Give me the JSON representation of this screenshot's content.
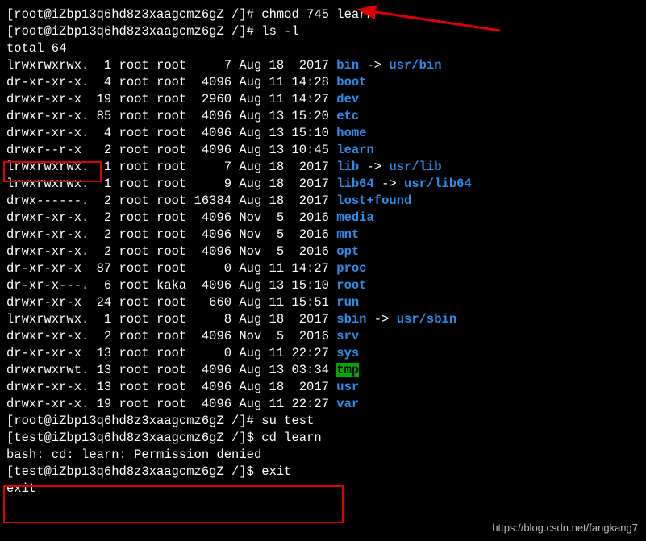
{
  "prompts": {
    "root": "[root@iZbp13q6hd8z3xaagcmz6gZ /]# ",
    "test": "[test@iZbp13q6hd8z3xaagcmz6gZ /]$ "
  },
  "cmds": {
    "chmod": "chmod 745 learn",
    "lsl": "ls -l",
    "su": "su test",
    "cd": "cd learn",
    "exit": "exit"
  },
  "total": "total 64",
  "arrow": " -> ",
  "rows": [
    {
      "perm": "lrwxrwxrwx.",
      "links": "1",
      "owner": "root",
      "group": "root",
      "size": "7",
      "date": "Aug 18  2017",
      "name": "bin",
      "type": "link",
      "target": "usr/bin"
    },
    {
      "perm": "dr-xr-xr-x.",
      "links": "4",
      "owner": "root",
      "group": "root",
      "size": "4096",
      "date": "Aug 11 14:28",
      "name": "boot",
      "type": "dir"
    },
    {
      "perm": "drwxr-xr-x",
      "links": "19",
      "owner": "root",
      "group": "root",
      "size": "2960",
      "date": "Aug 11 14:27",
      "name": "dev",
      "type": "dir"
    },
    {
      "perm": "drwxr-xr-x.",
      "links": "85",
      "owner": "root",
      "group": "root",
      "size": "4096",
      "date": "Aug 13 15:20",
      "name": "etc",
      "type": "dir"
    },
    {
      "perm": "drwxr-xr-x.",
      "links": "4",
      "owner": "root",
      "group": "root",
      "size": "4096",
      "date": "Aug 13 15:10",
      "name": "home",
      "type": "dir"
    },
    {
      "perm": "drwxr--r-x",
      "links": "2",
      "owner": "root",
      "group": "root",
      "size": "4096",
      "date": "Aug 13 10:45",
      "name": "learn",
      "type": "dir"
    },
    {
      "perm": "lrwxrwxrwx.",
      "links": "1",
      "owner": "root",
      "group": "root",
      "size": "7",
      "date": "Aug 18  2017",
      "name": "lib",
      "type": "link",
      "target": "usr/lib"
    },
    {
      "perm": "lrwxrwxrwx.",
      "links": "1",
      "owner": "root",
      "group": "root",
      "size": "9",
      "date": "Aug 18  2017",
      "name": "lib64",
      "type": "link",
      "target": "usr/lib64"
    },
    {
      "perm": "drwx------.",
      "links": "2",
      "owner": "root",
      "group": "root",
      "size": "16384",
      "date": "Aug 18  2017",
      "name": "lost+found",
      "type": "dir"
    },
    {
      "perm": "drwxr-xr-x.",
      "links": "2",
      "owner": "root",
      "group": "root",
      "size": "4096",
      "date": "Nov  5  2016",
      "name": "media",
      "type": "dir"
    },
    {
      "perm": "drwxr-xr-x.",
      "links": "2",
      "owner": "root",
      "group": "root",
      "size": "4096",
      "date": "Nov  5  2016",
      "name": "mnt",
      "type": "dir"
    },
    {
      "perm": "drwxr-xr-x.",
      "links": "2",
      "owner": "root",
      "group": "root",
      "size": "4096",
      "date": "Nov  5  2016",
      "name": "opt",
      "type": "dir"
    },
    {
      "perm": "dr-xr-xr-x",
      "links": "87",
      "owner": "root",
      "group": "root",
      "size": "0",
      "date": "Aug 11 14:27",
      "name": "proc",
      "type": "dir"
    },
    {
      "perm": "dr-xr-x---.",
      "links": "6",
      "owner": "root",
      "group": "kaka",
      "size": "4096",
      "date": "Aug 13 15:10",
      "name": "root",
      "type": "dir"
    },
    {
      "perm": "drwxr-xr-x",
      "links": "24",
      "owner": "root",
      "group": "root",
      "size": "660",
      "date": "Aug 11 15:51",
      "name": "run",
      "type": "dir"
    },
    {
      "perm": "lrwxrwxrwx.",
      "links": "1",
      "owner": "root",
      "group": "root",
      "size": "8",
      "date": "Aug 18  2017",
      "name": "sbin",
      "type": "link",
      "target": "usr/sbin"
    },
    {
      "perm": "drwxr-xr-x.",
      "links": "2",
      "owner": "root",
      "group": "root",
      "size": "4096",
      "date": "Nov  5  2016",
      "name": "srv",
      "type": "dir"
    },
    {
      "perm": "dr-xr-xr-x",
      "links": "13",
      "owner": "root",
      "group": "root",
      "size": "0",
      "date": "Aug 11 22:27",
      "name": "sys",
      "type": "dir"
    },
    {
      "perm": "drwxrwxrwt.",
      "links": "13",
      "owner": "root",
      "group": "root",
      "size": "4096",
      "date": "Aug 13 03:34",
      "name": "tmp",
      "type": "tmp"
    },
    {
      "perm": "drwxr-xr-x.",
      "links": "13",
      "owner": "root",
      "group": "root",
      "size": "4096",
      "date": "Aug 18  2017",
      "name": "usr",
      "type": "dir"
    },
    {
      "perm": "drwxr-xr-x.",
      "links": "19",
      "owner": "root",
      "group": "root",
      "size": "4096",
      "date": "Aug 11 22:27",
      "name": "var",
      "type": "dir"
    }
  ],
  "error": "bash: cd: learn: Permission denied",
  "exit_out": "exit",
  "watermark": "https://blog.csdn.net/fangkang7"
}
